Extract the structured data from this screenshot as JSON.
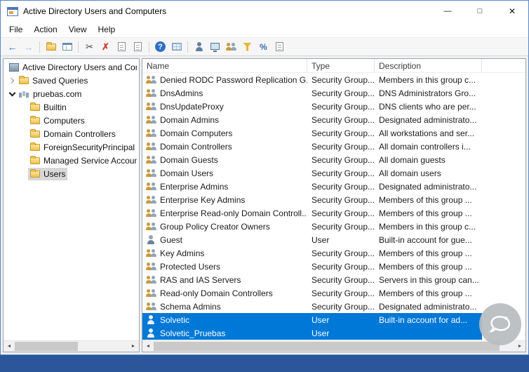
{
  "window": {
    "title": "Active Directory Users and Computers",
    "controls": [
      {
        "name": "minimize",
        "glyph": "—"
      },
      {
        "name": "maximize",
        "glyph": "□"
      },
      {
        "name": "close",
        "glyph": "✕"
      }
    ]
  },
  "menu": {
    "items": [
      "File",
      "Action",
      "View",
      "Help"
    ]
  },
  "toolbar": {
    "items": [
      {
        "name": "back",
        "glyph": "←"
      },
      {
        "name": "forward",
        "glyph": "→"
      },
      {
        "name": "up-one-level",
        "glyph": ""
      },
      {
        "name": "show-console-tree",
        "glyph": ""
      },
      {
        "name": "cut",
        "glyph": "✂"
      },
      {
        "name": "delete",
        "glyph": "✗"
      },
      {
        "name": "properties",
        "glyph": ""
      },
      {
        "name": "export-list",
        "glyph": ""
      },
      {
        "name": "help",
        "glyph": "?"
      },
      {
        "name": "column-options",
        "glyph": ""
      },
      {
        "name": "new-user",
        "glyph": ""
      },
      {
        "name": "new-computer",
        "glyph": ""
      },
      {
        "name": "new-group",
        "glyph": ""
      },
      {
        "name": "set-filter",
        "glyph": ""
      },
      {
        "name": "advanced-options",
        "glyph": "%"
      },
      {
        "name": "console-message",
        "glyph": ""
      }
    ]
  },
  "tree": {
    "items": [
      {
        "label": "Active Directory Users and Com"
      },
      {
        "label": "Saved Queries"
      },
      {
        "label": "pruebas.com"
      },
      {
        "label": "Builtin"
      },
      {
        "label": "Computers"
      },
      {
        "label": "Domain Controllers"
      },
      {
        "label": "ForeignSecurityPrincipal"
      },
      {
        "label": "Managed Service Accoun"
      },
      {
        "label": "Users"
      }
    ]
  },
  "list": {
    "columns": [
      {
        "label": "Name"
      },
      {
        "label": "Type"
      },
      {
        "label": "Description"
      }
    ],
    "rows": [
      {
        "icon": "security-group",
        "name": "Denied RODC Password Replication G...",
        "type": "Security Group...",
        "desc": "Members in this group c..."
      },
      {
        "icon": "security-group",
        "name": "DnsAdmins",
        "type": "Security Group...",
        "desc": "DNS Administrators Gro..."
      },
      {
        "icon": "security-group",
        "name": "DnsUpdateProxy",
        "type": "Security Group...",
        "desc": "DNS clients who are per..."
      },
      {
        "icon": "security-group",
        "name": "Domain Admins",
        "type": "Security Group...",
        "desc": "Designated administrato..."
      },
      {
        "icon": "security-group",
        "name": "Domain Computers",
        "type": "Security Group...",
        "desc": "All workstations and ser..."
      },
      {
        "icon": "security-group",
        "name": "Domain Controllers",
        "type": "Security Group...",
        "desc": "All domain controllers i..."
      },
      {
        "icon": "security-group",
        "name": "Domain Guests",
        "type": "Security Group...",
        "desc": "All domain guests"
      },
      {
        "icon": "security-group",
        "name": "Domain Users",
        "type": "Security Group...",
        "desc": "All domain users"
      },
      {
        "icon": "security-group",
        "name": "Enterprise Admins",
        "type": "Security Group...",
        "desc": "Designated administrato..."
      },
      {
        "icon": "security-group",
        "name": "Enterprise Key Admins",
        "type": "Security Group...",
        "desc": "Members of this group ..."
      },
      {
        "icon": "security-group",
        "name": "Enterprise Read-only Domain Controll...",
        "type": "Security Group...",
        "desc": "Members of this group ..."
      },
      {
        "icon": "security-group",
        "name": "Group Policy Creator Owners",
        "type": "Security Group...",
        "desc": "Members in this group c..."
      },
      {
        "icon": "user",
        "name": "Guest",
        "type": "User",
        "desc": "Built-in account for gue..."
      },
      {
        "icon": "security-group",
        "name": "Key Admins",
        "type": "Security Group...",
        "desc": "Members of this group ..."
      },
      {
        "icon": "security-group",
        "name": "Protected Users",
        "type": "Security Group...",
        "desc": "Members of this group ..."
      },
      {
        "icon": "security-group",
        "name": "RAS and IAS Servers",
        "type": "Security Group...",
        "desc": "Servers in this group can..."
      },
      {
        "icon": "security-group",
        "name": "Read-only Domain Controllers",
        "type": "Security Group...",
        "desc": "Members of this group ..."
      },
      {
        "icon": "security-group",
        "name": "Schema Admins",
        "type": "Security Group...",
        "desc": "Designated administrato..."
      },
      {
        "icon": "user",
        "name": "Solvetic",
        "type": "User",
        "desc": "Built-in account for ad...",
        "selected": true
      },
      {
        "icon": "user",
        "name": "Solvetic_Pruebas",
        "type": "User",
        "desc": "",
        "selected": true
      }
    ]
  },
  "scrollbar": {
    "left_glyph": "◄",
    "right_glyph": "►"
  },
  "colors": {
    "selection": "#0078d7",
    "selection_text": "#ffffff",
    "taskbar": "#2b579a"
  },
  "watermark": {
    "icon": "solvetic-logo"
  }
}
